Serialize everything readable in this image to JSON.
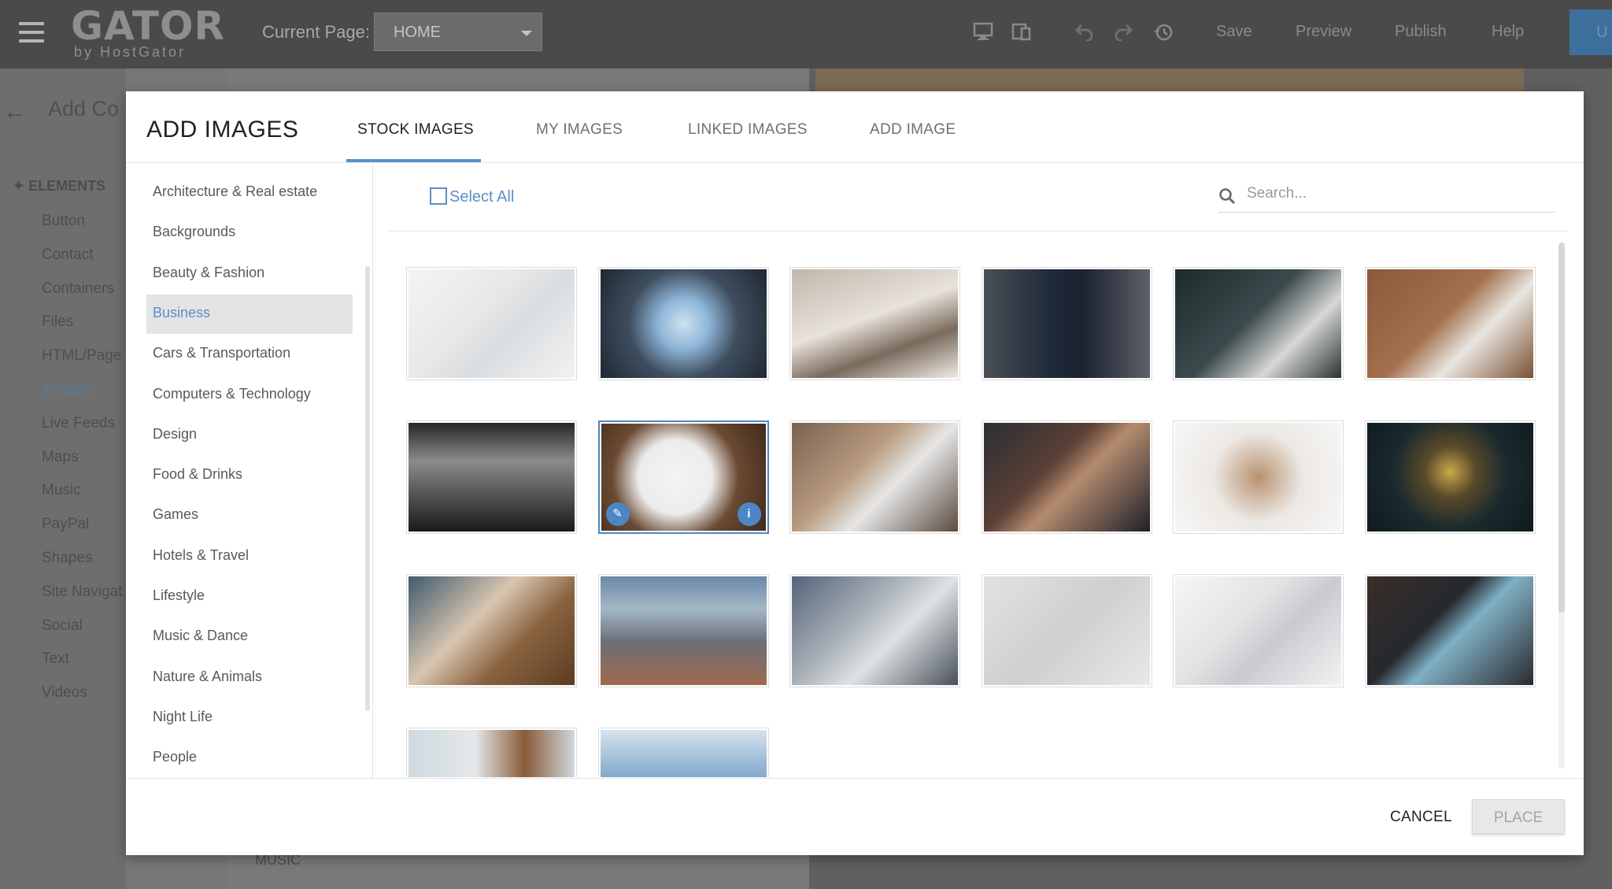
{
  "editor": {
    "logo_big": "GATOR",
    "logo_small": "by HostGator",
    "current_page_label": "Current Page:",
    "current_page_value": "HOME",
    "toolbar": {
      "save": "Save",
      "preview": "Preview",
      "publish": "Publish",
      "help": "Help",
      "upgrade_partial": "U"
    },
    "panel_title_partial": "Add Co",
    "elements_heading": "ELEMENTS",
    "elements": [
      {
        "label": "Button"
      },
      {
        "label": "Contact"
      },
      {
        "label": "Containers"
      },
      {
        "label": "Files"
      },
      {
        "label": "HTML/Page"
      },
      {
        "label": "Images"
      },
      {
        "label": "Live Feeds"
      },
      {
        "label": "Maps"
      },
      {
        "label": "Music"
      },
      {
        "label": "PayPal"
      },
      {
        "label": "Shapes"
      },
      {
        "label": "Site Navigat"
      },
      {
        "label": "Social"
      },
      {
        "label": "Text"
      },
      {
        "label": "Videos"
      }
    ],
    "active_element": "Images",
    "bottom_label": "MUSIC"
  },
  "modal": {
    "title": "ADD IMAGES",
    "tabs": [
      {
        "label": "STOCK IMAGES",
        "active": true
      },
      {
        "label": "MY IMAGES",
        "active": false
      },
      {
        "label": "LINKED IMAGES",
        "active": false
      },
      {
        "label": "ADD IMAGE",
        "active": false
      }
    ],
    "categories": [
      {
        "label": "Architecture & Real estate"
      },
      {
        "label": "Backgrounds"
      },
      {
        "label": "Beauty & Fashion"
      },
      {
        "label": "Business"
      },
      {
        "label": "Cars & Transportation"
      },
      {
        "label": "Computers & Technology"
      },
      {
        "label": "Design"
      },
      {
        "label": "Food & Drinks"
      },
      {
        "label": "Games"
      },
      {
        "label": "Hotels & Travel"
      },
      {
        "label": "Lifestyle"
      },
      {
        "label": "Music & Dance"
      },
      {
        "label": "Nature & Animals"
      },
      {
        "label": "Night Life"
      },
      {
        "label": "People"
      }
    ],
    "selected_category": "Business",
    "select_all_label": "Select All",
    "search_placeholder": "Search...",
    "images": [
      {
        "name": "desk-laptop-documents"
      },
      {
        "name": "skyscrapers-from-below"
      },
      {
        "name": "business-handshake"
      },
      {
        "name": "man-in-suit"
      },
      {
        "name": "team-meeting-tablet"
      },
      {
        "name": "desk-top-view-laptop"
      },
      {
        "name": "city-window-silhouettes"
      },
      {
        "name": "whiteboard-plan",
        "selected": true
      },
      {
        "name": "team-desk-laptops"
      },
      {
        "name": "discussion-laptop"
      },
      {
        "name": "stacked-hands"
      },
      {
        "name": "lightbulb-in-hands"
      },
      {
        "name": "hands-on-tablet"
      },
      {
        "name": "city-aerial-view"
      },
      {
        "name": "laptop-documents-review"
      },
      {
        "name": "minimal-stairway"
      },
      {
        "name": "desk-phone-calculator"
      },
      {
        "name": "laptop-dashboard"
      },
      {
        "name": "business-newspaper-wallet"
      },
      {
        "name": "sky-clouds"
      }
    ],
    "cancel_label": "CANCEL",
    "place_label": "PLACE",
    "colors": {
      "accent": "#5b8fc7",
      "selected_bg": "#e4e4e4"
    }
  }
}
